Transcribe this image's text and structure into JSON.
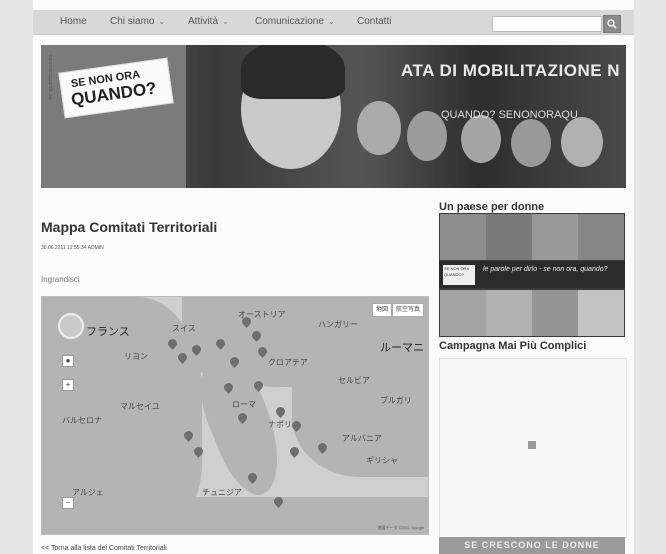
{
  "nav": {
    "items": [
      {
        "label": "Home",
        "caret": ""
      },
      {
        "label": "Chi siamo",
        "caret": "⌄"
      },
      {
        "label": "Attività",
        "caret": "⌄"
      },
      {
        "label": "Comunicazione",
        "caret": "⌄"
      },
      {
        "label": "Contatti",
        "caret": ""
      }
    ],
    "search_placeholder": "",
    "search_icon": "search-icon"
  },
  "banner": {
    "sign_line1": "SE NON ORA",
    "sign_line2": "QUANDO?",
    "vertical_text": "senonoraquando.eu",
    "headline": "ATA DI MOBILITAZIONE N",
    "subline": "QUANDO? SENONORAQU"
  },
  "article": {
    "title": "Mappa Comitati Territoriali",
    "date": "30.06.2011 12:55:34 ADMIN",
    "enlarge": "Ingrandisci",
    "back_link": "<< Torna alla lista dei Comitati Territoriali"
  },
  "map": {
    "type_buttons": [
      "地図",
      "航空写真"
    ],
    "labels": [
      {
        "text": "フランス",
        "big": true
      },
      {
        "text": "スイス",
        "big": false
      },
      {
        "text": "オーストリア",
        "big": false
      },
      {
        "text": "ハンガリー",
        "big": false
      },
      {
        "text": "ルーマニ",
        "big": true
      },
      {
        "text": "クロアチア",
        "big": false
      },
      {
        "text": "セルビア",
        "big": false
      },
      {
        "text": "ブルガリ",
        "big": false
      },
      {
        "text": "アルバニア",
        "big": false
      },
      {
        "text": "ギリシャ",
        "big": false
      },
      {
        "text": "リヨン",
        "big": false
      },
      {
        "text": "マルセイユ",
        "big": false
      },
      {
        "text": "バルセロナ",
        "big": false
      },
      {
        "text": "チュニジア",
        "big": false
      },
      {
        "text": "アルジェ",
        "big": false
      },
      {
        "text": "ナポリ",
        "big": false
      },
      {
        "text": "ローマ",
        "big": false
      }
    ],
    "attribution": "地図データ ©2011 Google"
  },
  "sidebar": {
    "section1_title": "Un paese per donne",
    "mosaic_caption": "le parole per dirlo - se non ora, quando?",
    "mosaic_tag": "SE NON ORA QUANDO?",
    "section2_title": "Campagna Mai Più Complici",
    "bottom_banner": "SE CRESCONO LE DONNE"
  }
}
